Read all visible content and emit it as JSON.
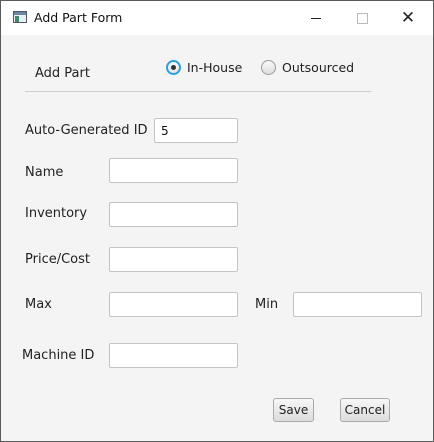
{
  "window": {
    "title": "Add Part Form"
  },
  "form": {
    "heading": "Add Part",
    "source_options": [
      {
        "label": "In-House",
        "selected": true
      },
      {
        "label": "Outsourced",
        "selected": false
      }
    ],
    "fields": {
      "id": {
        "label": "Auto-Generated ID",
        "value": "5"
      },
      "name": {
        "label": "Name",
        "value": ""
      },
      "inventory": {
        "label": "Inventory",
        "value": ""
      },
      "price": {
        "label": "Price/Cost",
        "value": ""
      },
      "max": {
        "label": "Max",
        "value": ""
      },
      "min": {
        "label": "Min",
        "value": ""
      },
      "machine_id": {
        "label": "Machine ID",
        "value": ""
      }
    },
    "buttons": {
      "save": "Save",
      "cancel": "Cancel"
    }
  },
  "colors": {
    "accent": "#2a9fd8",
    "background": "#f4f4f4",
    "titlebar": "#ffffff"
  }
}
